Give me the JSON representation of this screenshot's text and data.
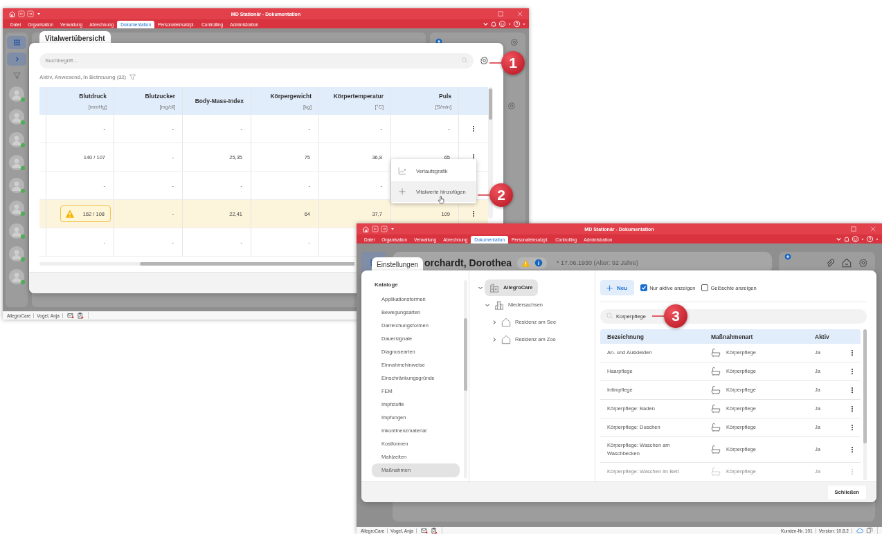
{
  "vitals_window": {
    "title": "MD Stationär - Dokumentation",
    "menu": [
      {
        "label": "Datei",
        "selected": false
      },
      {
        "label": "Organisation",
        "selected": false
      },
      {
        "label": "Verwaltung",
        "selected": false
      },
      {
        "label": "Abrechnung",
        "selected": false
      },
      {
        "label": "Dokumentation",
        "selected": true
      },
      {
        "label": "Personaleinsatzpl.",
        "selected": false
      },
      {
        "label": "Controlling",
        "selected": false
      },
      {
        "label": "Administration",
        "selected": false
      }
    ],
    "residents": [
      {
        "present": true
      },
      {
        "present": true
      },
      {
        "present": true
      },
      {
        "present": true
      },
      {
        "present": true
      },
      {
        "present": true
      },
      {
        "present": true
      },
      {
        "present": true
      },
      {
        "present": true
      }
    ],
    "dialog": {
      "tab": "Vitalwertübersicht",
      "search_placeholder": "Suchbegriff...",
      "filter": "Aktiv, Anwesend, In Betreuung (32)",
      "columns": [
        {
          "name": "Blutdruck",
          "unit": "[mmHg]"
        },
        {
          "name": "Blutzucker",
          "unit": "[mg/dl]"
        },
        {
          "name": "Body-Mass-Index"
        },
        {
          "name": "Körpergewicht",
          "unit": "[kg]"
        },
        {
          "name": "Körpertemperatur",
          "unit": "[°C]"
        },
        {
          "name": "Puls",
          "unit": "[S/min]"
        }
      ],
      "rows": [
        {
          "highlighted": false,
          "warning": false,
          "cells": [
            "-",
            "-",
            "-",
            "-",
            "-",
            "-"
          ]
        },
        {
          "highlighted": false,
          "warning": false,
          "cells": [
            "140 / 107",
            "-",
            "25,35",
            "75",
            "36,8",
            "65"
          ]
        },
        {
          "highlighted": false,
          "warning": false,
          "cells": [
            "-",
            "-",
            "-",
            "-",
            "-"
          ]
        },
        {
          "highlighted": true,
          "warning": true,
          "cells": [
            "162 / 108",
            "-",
            "22,41",
            "64",
            "37,7",
            "109"
          ]
        },
        {
          "highlighted": false,
          "warning": false,
          "cells": [
            "-",
            "-",
            "-",
            "-"
          ]
        }
      ],
      "context_menu": [
        {
          "kind": "chart",
          "label": "Verlaufsgrafik",
          "selected": false
        },
        {
          "kind": "add",
          "label": "Vitalwerte hinzufügen",
          "selected": true
        }
      ]
    },
    "status_bar": {
      "left": [
        "AllegroCare",
        "Vogel, Anja"
      ]
    }
  },
  "settings_window": {
    "title": "MD Stationär - Dokumentation",
    "menu": [
      {
        "label": "Datei",
        "selected": false
      },
      {
        "label": "Organisation",
        "selected": false
      },
      {
        "label": "Verwaltung",
        "selected": false
      },
      {
        "label": "Abrechnung",
        "selected": false
      },
      {
        "label": "Dokumentation",
        "selected": true
      },
      {
        "label": "Personaleinsatzpl.",
        "selected": false
      },
      {
        "label": "Controlling",
        "selected": false
      },
      {
        "label": "Administration",
        "selected": false
      }
    ],
    "patient": {
      "name": "orchardt, Dorothea",
      "birth": "* 17.06.1930 (Alter: 92 Jahre)"
    },
    "dialog": {
      "tab": "Einstellungen",
      "catalog_heading": "Kataloge",
      "catalogs": [
        {
          "label": "Applikationsformen",
          "selected": false
        },
        {
          "label": "Bewegungsarten",
          "selected": false
        },
        {
          "label": "Darreichungsformen",
          "selected": false
        },
        {
          "label": "Dauersignale",
          "selected": false
        },
        {
          "label": "Diagnosearten",
          "selected": false
        },
        {
          "label": "Einnahmehinweise",
          "selected": false
        },
        {
          "label": "Einschränkungsgründe",
          "selected": false
        },
        {
          "label": "FEM",
          "selected": false
        },
        {
          "label": "Impfstoffe",
          "selected": false
        },
        {
          "label": "Impfungen",
          "selected": false
        },
        {
          "label": "Inkontinenzmaterial",
          "selected": false
        },
        {
          "label": "Kostformen",
          "selected": false
        },
        {
          "label": "Mahlzeiten",
          "selected": false
        },
        {
          "label": "Maßnahmen",
          "selected": true
        }
      ],
      "tree": [
        {
          "label": "AllegroCare",
          "kind": "organization",
          "expanded": true,
          "selected": true,
          "children": [
            {
              "label": "Niedersachsen",
              "kind": "region",
              "expanded": true,
              "selected": false,
              "children": [
                {
                  "label": "Residenz am See",
                  "kind": "facility",
                  "expanded": false,
                  "selected": false
                },
                {
                  "label": "Residenz am Zoo",
                  "kind": "facility",
                  "expanded": false,
                  "selected": false
                }
              ]
            }
          ]
        }
      ],
      "new_button": "Neu",
      "filters": [
        {
          "label": "Nur aktive anzeigen",
          "checked": true
        },
        {
          "label": "Gelöschte anzeigen",
          "checked": false
        }
      ],
      "search_value": "Korperpflege",
      "columns": [
        "Bezeichnung",
        "Maßnahmenart",
        "Aktiv"
      ],
      "rows": [
        {
          "name": "An- und Auskleiden",
          "type": "Körperpflege",
          "active": "Ja",
          "faded": false
        },
        {
          "name": "Haarpflege",
          "type": "Körperpflege",
          "active": "Ja",
          "faded": false
        },
        {
          "name": "Intimpflege",
          "type": "Körperpflege",
          "active": "Ja",
          "faded": false
        },
        {
          "name": "Körperpflege: Baden",
          "type": "Körperpflege",
          "active": "Ja",
          "faded": false
        },
        {
          "name": "Körperpflege: Duschen",
          "type": "Körperpflege",
          "active": "Ja",
          "faded": false
        },
        {
          "name": "Körperpflege: Waschen am Waschbecken",
          "type": "Körperpflege",
          "active": "Ja",
          "faded": false
        },
        {
          "name": "Körperpflege: Waschen im Bett",
          "type": "Körperpflege",
          "active": "Ja",
          "faded": true
        }
      ],
      "close_button": "Schließen"
    },
    "status_bar": {
      "left": [
        "AllegroCare",
        "Vogel, Anja"
      ],
      "right": [
        "Kunden-Nr. 101",
        "Version: 10.8.2"
      ]
    }
  },
  "callouts": [
    {
      "number": "1"
    },
    {
      "number": "2"
    },
    {
      "number": "3"
    }
  ]
}
